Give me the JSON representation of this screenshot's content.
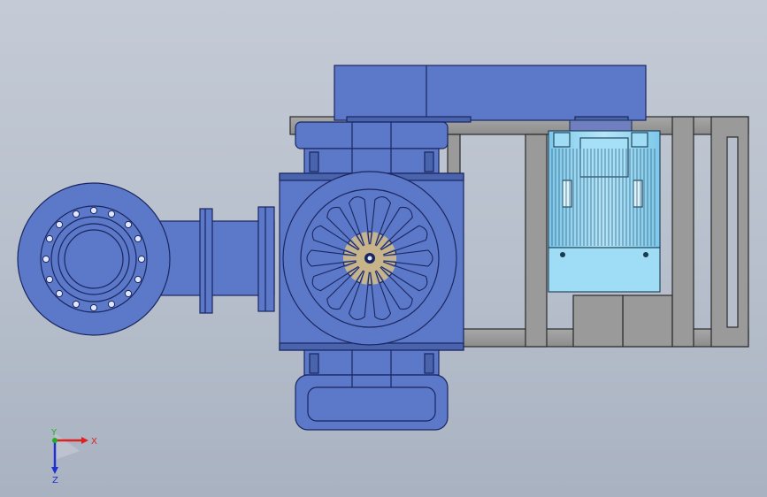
{
  "viewport": {
    "background_top": "#c4cbd6",
    "background_bottom": "#a9b2c1"
  },
  "model": {
    "pump_color": "#5c78c8",
    "frame_color": "#9a9a9a",
    "motor_color": "#9fdcf5",
    "impeller_blade_color": "#c8b48a"
  },
  "triad": {
    "x_label": "X",
    "y_label": "Y",
    "z_label": "Z",
    "x_color": "#e02020",
    "y_color": "#20b020",
    "z_color": "#2030d0"
  }
}
